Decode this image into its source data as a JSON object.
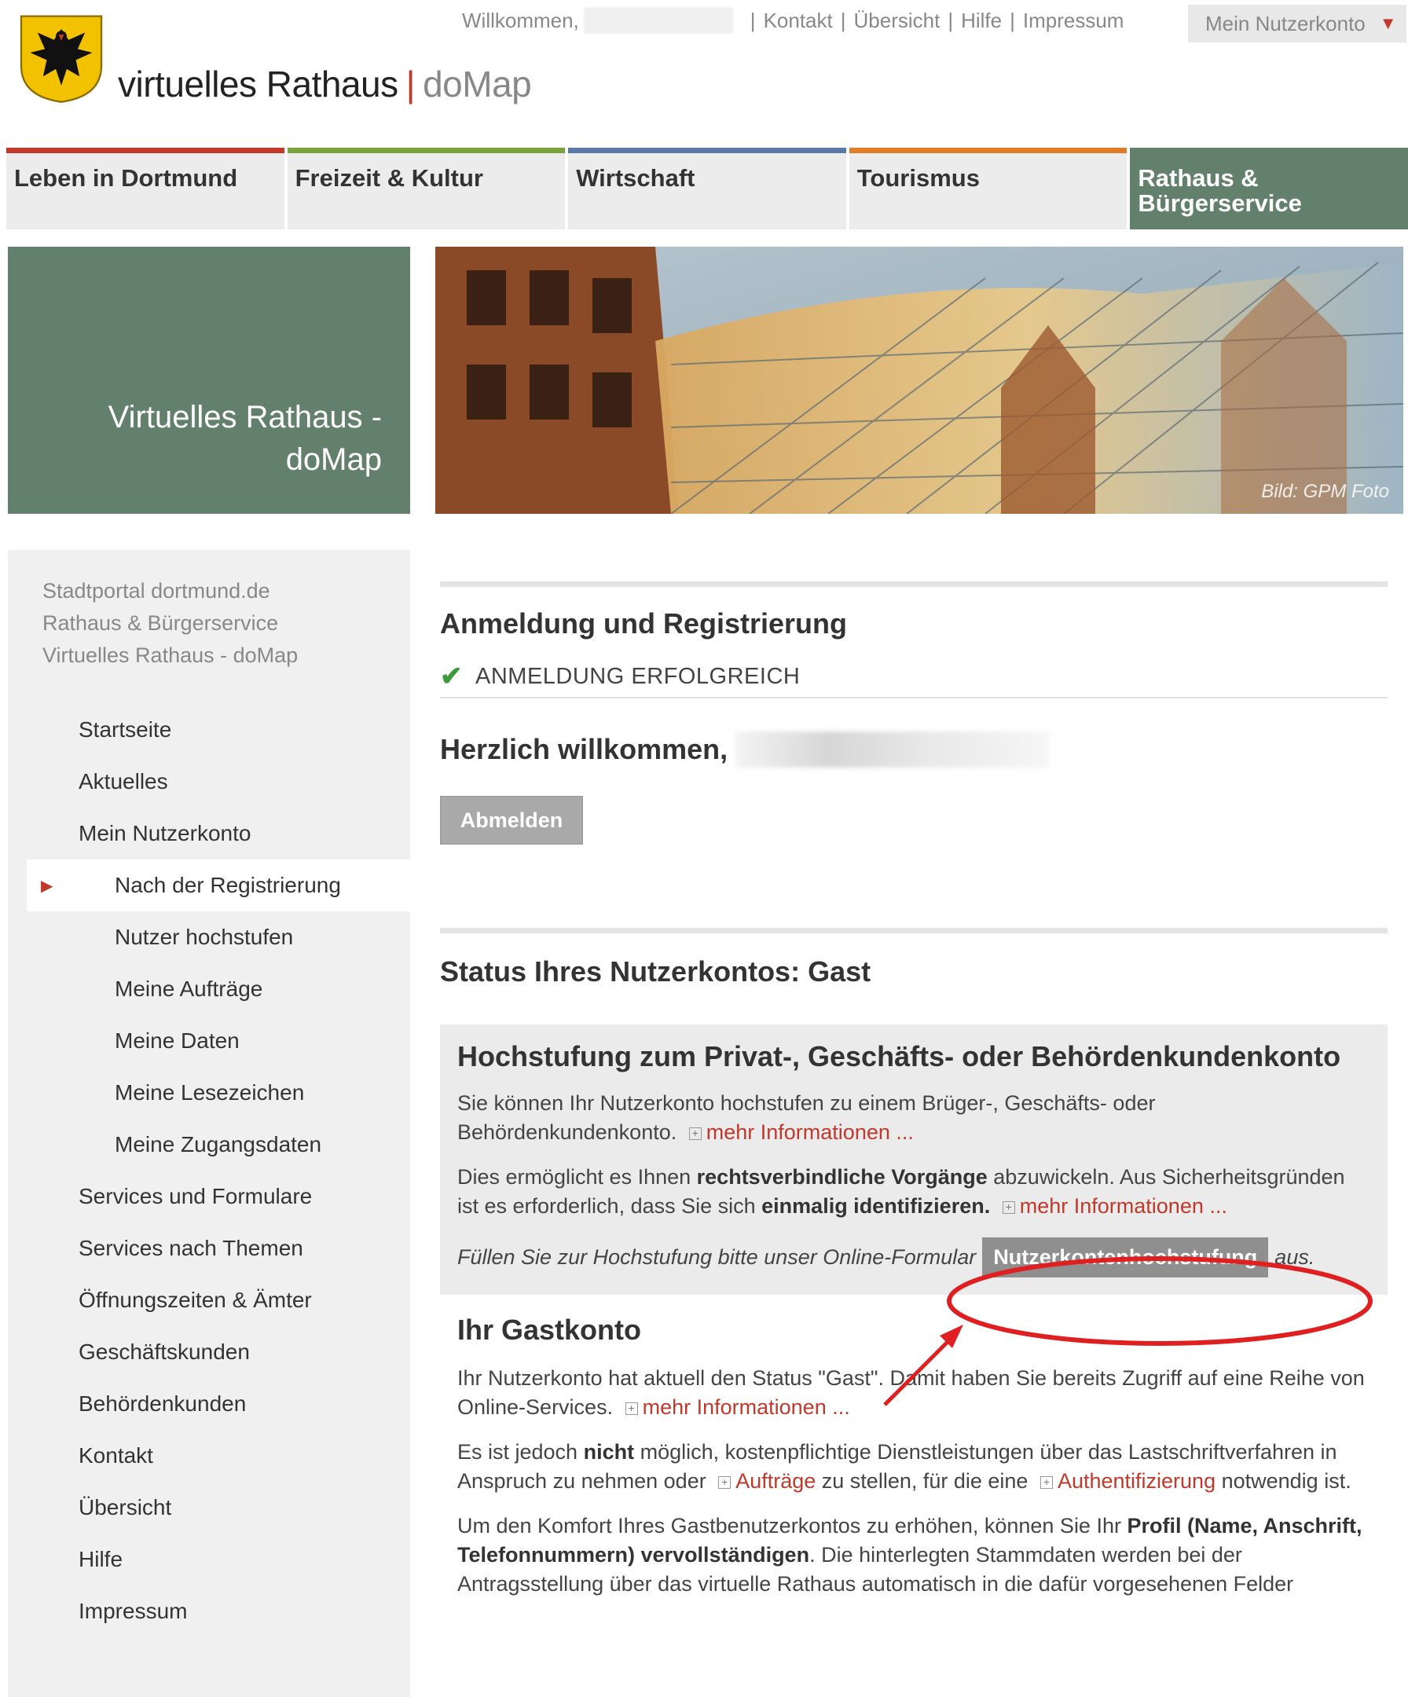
{
  "header": {
    "welcome": "Willkommen,",
    "links": [
      "Kontakt",
      "Übersicht",
      "Hilfe",
      "Impressum"
    ],
    "account_button": "Mein Nutzerkonto",
    "brand_main": "virtuelles Rathaus",
    "brand_sep": "|",
    "brand_sub": "doMap"
  },
  "nav": [
    {
      "label": "Leben in Dortmund"
    },
    {
      "label": "Freizeit & Kultur"
    },
    {
      "label": "Wirtschaft"
    },
    {
      "label": "Tourismus"
    },
    {
      "label": "Rathaus & Bürgerservice"
    }
  ],
  "banner": {
    "title_line1": "Virtuelles Rathaus -",
    "title_line2": "doMap",
    "credit": "Bild: GPM Foto"
  },
  "breadcrumbs": [
    "Stadtportal dortmund.de",
    "Rathaus & Bürgerservice",
    "Virtuelles Rathaus - doMap"
  ],
  "sidebar": [
    {
      "label": "Startseite"
    },
    {
      "label": "Aktuelles"
    },
    {
      "label": "Mein Nutzerkonto"
    },
    {
      "label": "Nach der Registrierung"
    },
    {
      "label": "Nutzer hochstufen"
    },
    {
      "label": "Meine Aufträge"
    },
    {
      "label": "Meine Daten"
    },
    {
      "label": "Meine Lesezeichen"
    },
    {
      "label": "Meine Zugangsdaten"
    },
    {
      "label": "Services und Formulare"
    },
    {
      "label": "Services nach Themen"
    },
    {
      "label": "Öffnungszeiten & Ämter"
    },
    {
      "label": "Geschäftskunden"
    },
    {
      "label": "Behördenkunden"
    },
    {
      "label": "Kontakt"
    },
    {
      "label": "Übersicht"
    },
    {
      "label": "Hilfe"
    },
    {
      "label": "Impressum"
    }
  ],
  "main": {
    "heading": "Anmeldung und Registrierung",
    "success": "ANMELDUNG ERFOLGREICH",
    "welcome": "Herzlich willkommen,",
    "logout": "Abmelden",
    "status": "Status Ihres Nutzerkontos: Gast",
    "upgrade": {
      "title": "Hochstufung zum Privat-, Geschäfts- oder Behördenkundenkonto",
      "p1": "Sie können Ihr Nutzerkonto hochstufen zu einem Brüger-, Geschäfts- oder Behördenkundenkonto.",
      "p1_link": "mehr Informationen ...",
      "p2_a": "Dies ermöglicht es Ihnen ",
      "p2_b": "rechtsverbindliche Vorgänge",
      "p2_c": " abzuwickeln. Aus Sicherheitsgründen ist es erforderlich, dass Sie sich ",
      "p2_d": "einmalig identifizieren.",
      "p2_link": "mehr Informationen ...",
      "p3_a": "Füllen Sie zur Hochstufung bitte unser Online-Formular",
      "p3_button": "Nutzerkontenhochstufung",
      "p3_b": "aus."
    },
    "gast": {
      "title": "Ihr Gastkonto",
      "p1": "Ihr Nutzerkonto hat aktuell den Status \"Gast\". Damit haben Sie bereits Zugriff auf eine Reihe von Online-Services.",
      "p1_link": "mehr Informationen ...",
      "p2_a": "Es ist jedoch ",
      "p2_b": "nicht",
      "p2_c": " möglich, kostenpflichtige Dienstleistungen über das Lastschriftverfahren in Anspruch zu nehmen oder ",
      "p2_link1": "Aufträge",
      "p2_d": " zu stellen, für die eine ",
      "p2_link2": "Authentifizierung",
      "p2_e": " notwendig ist.",
      "p3_a": "Um den Komfort Ihres Gastbenutzerkontos zu erhöhen, können Sie Ihr ",
      "p3_b": "Profil (Name, Anschrift, Telefonnummern) vervollständigen",
      "p3_c": ". Die hinterlegten Stammdaten werden bei der Antragsstellung über das virtuelle Rathaus automatisch in die dafür vorgesehenen Felder"
    }
  },
  "colors": {
    "accent_red": "#c0392b",
    "green_panel": "#62806c",
    "annotation_red": "#e02020"
  }
}
